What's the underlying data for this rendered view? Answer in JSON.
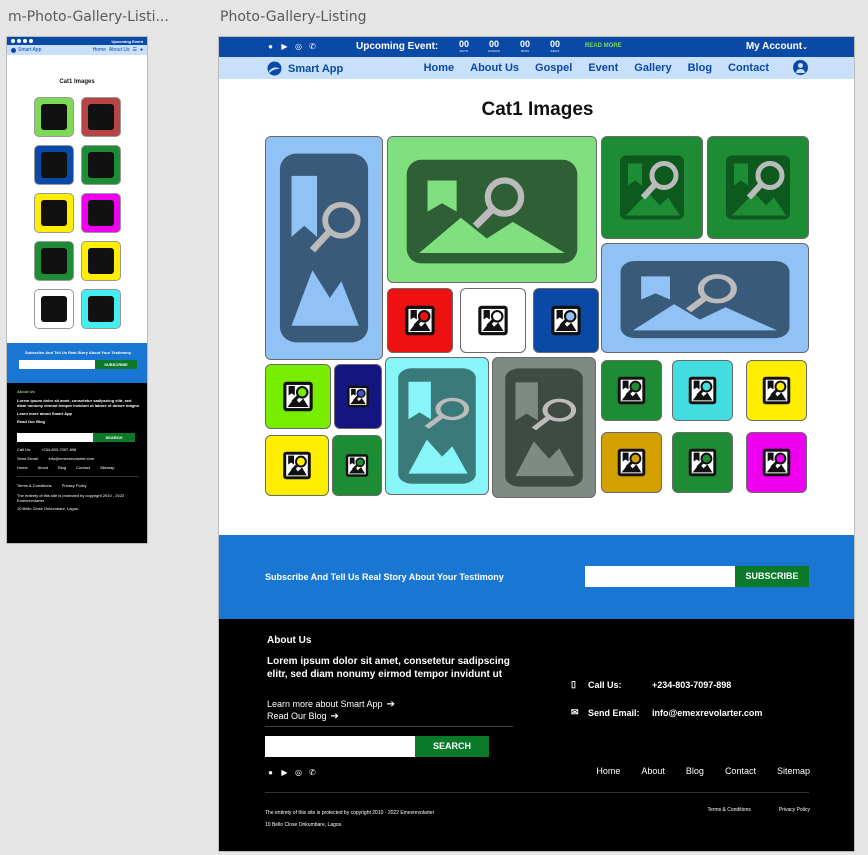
{
  "canvas": {
    "mobile_label": "m-Photo-Gallery-Listi...",
    "desktop_label": "Photo-Gallery-Listing"
  },
  "topbar": {
    "event_title": "Upcoming Event:",
    "countdown": [
      {
        "value": "00",
        "unit": "DAYS"
      },
      {
        "value": "00",
        "unit": "HOURS"
      },
      {
        "value": "00",
        "unit": "MINS"
      },
      {
        "value": "00",
        "unit": "SECS"
      }
    ],
    "read_more": "READ MORE",
    "account": "My Account",
    "social_icons": [
      "facebook-icon",
      "youtube-icon",
      "instagram-icon",
      "whatsapp-icon"
    ]
  },
  "nav": {
    "brand": "Smart App",
    "links": [
      "Home",
      "About Us",
      "Gospel",
      "Event",
      "Gallery",
      "Blog",
      "Contact"
    ]
  },
  "gallery": {
    "title": "Cat1 Images",
    "tiles": [
      {
        "bg": "#90c2f5",
        "shape": "portrait",
        "art": "#3a5a7a",
        "fg": "#90c2f5"
      },
      {
        "bg": "#80e080",
        "shape": "landscape",
        "art": "#2f5f35",
        "fg": "#80e080"
      },
      {
        "bg": "#1e8c35",
        "shape": "square",
        "art": "#0e5a1e",
        "fg": "#1e8c35"
      },
      {
        "bg": "#1e8c35",
        "shape": "square",
        "art": "#0e5a1e",
        "fg": "#1e8c35"
      },
      {
        "bg": "#90c2f5",
        "shape": "landscape",
        "art": "#3a5a7a",
        "fg": "#90c2f5"
      },
      {
        "bg": "#ee1111",
        "shape": "small",
        "art": "#111111",
        "fg": "#ee1111"
      },
      {
        "bg": "#ffffff",
        "shape": "small",
        "art": "#111111",
        "fg": "#ffffff"
      },
      {
        "bg": "#0b49a6",
        "shape": "small",
        "art": "#111111",
        "fg": "#90c2f5"
      },
      {
        "bg": "#77ee00",
        "shape": "small",
        "art": "#111111",
        "fg": "#77ee00"
      },
      {
        "bg": "#151580",
        "shape": "small",
        "art": "#111111",
        "fg": "#4455cc"
      },
      {
        "bg": "#88f5f8",
        "shape": "portrait",
        "art": "#3a7a7a",
        "fg": "#88f5f8"
      },
      {
        "bg": "#7f8a82",
        "shape": "portrait",
        "art": "#3f4a42",
        "fg": "#7f8a82"
      },
      {
        "bg": "#1e8c35",
        "shape": "small",
        "art": "#111111",
        "fg": "#1e8c35"
      },
      {
        "bg": "#44dde0",
        "shape": "small",
        "art": "#111111",
        "fg": "#44dde0"
      },
      {
        "bg": "#ffee00",
        "shape": "small",
        "art": "#111111",
        "fg": "#ffee00"
      },
      {
        "bg": "#ffee00",
        "shape": "small",
        "art": "#111111",
        "fg": "#ffee00"
      },
      {
        "bg": "#1e8c35",
        "shape": "small",
        "art": "#111111",
        "fg": "#1e8c35"
      },
      {
        "bg": "#d4a000",
        "shape": "small",
        "art": "#111111",
        "fg": "#d4a000"
      },
      {
        "bg": "#1e8c35",
        "shape": "small",
        "art": "#111111",
        "fg": "#1e8c35"
      },
      {
        "bg": "#ee00ee",
        "shape": "small",
        "art": "#111111",
        "fg": "#ee00ee"
      }
    ]
  },
  "subscribe": {
    "text": "Subscribe And Tell Us Real Story About Your Testimony",
    "button": "SUBSCRIBE"
  },
  "footer": {
    "about_heading": "About Us",
    "about_text": "Lorem ipsum dolor sit amet, consetetur sadipscing elitr, sed diam nonumy eirmod tempor invidunt ut",
    "learn_more": "Learn more about Smart App",
    "read_blog": "Read Our Blog",
    "search_button": "SEARCH",
    "call_label": "Call Us:",
    "call_value": "+234-803-7097-898",
    "email_label": "Send Email:",
    "email_value": "info@emexrevolarter.com",
    "links": [
      "Home",
      "About",
      "Blog",
      "Contact",
      "Sitemap"
    ],
    "copyright_1": "The entirety of this site is protected by copyright  2010 - 2022 Emexrevolarter",
    "copyright_2": "10 Bello Close Onkumbare, Lagos.",
    "terms": "Terms & Conditions",
    "privacy": "Privacy Policy"
  },
  "mobile": {
    "event": "Upcoming Event",
    "brand": "Smart App",
    "nav_home": "Home",
    "nav_about": "About Us",
    "title": "Cat1 Images",
    "tile_colors": [
      "#7ed957",
      "#b84545",
      "#0b49a6",
      "#1e8c35",
      "#ffee00",
      "#ee00ee",
      "#1e8c35",
      "#ffee00",
      "#ffffff",
      "#44eeee"
    ],
    "sub_text": "Subscribe And Tell Us Real Story About Your Testimony",
    "sub_button": "SUBSCRIBE",
    "about": "About Us",
    "about_text": "Lorem ipsum dolor sit amet, consetetur sadipscing elitr, sed diam nonumy eirmod tempor invidunt ut labore et dolore magna",
    "learn_more": "Learn more about Smart App",
    "read_blog": "Read Our Blog",
    "search": "SEARCH",
    "call": "Call Us:",
    "call_value": "+234-803-7097-898",
    "email": "Send Email:",
    "email_value": "info@emexrevolarter.com",
    "links": [
      "Home",
      "About",
      "Blog",
      "Contact",
      "Sitemap"
    ],
    "terms": "Terms & Conditions",
    "privacy": "Privacy Policy",
    "copyright": "The entirety of this site is protected by copyright  2010 - 2022 Emexrevolarter",
    "address": "10 Bello Close Onkumbare, Lagos."
  }
}
